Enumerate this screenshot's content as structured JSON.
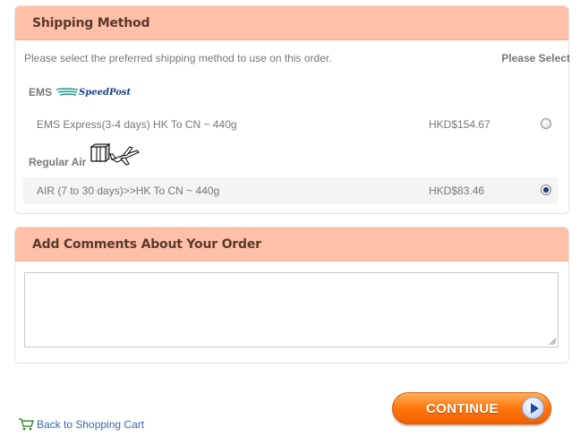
{
  "shipping": {
    "title": "Shipping Method",
    "intro": "Please select the preferred shipping method to use on this order.",
    "please_select": "Please Select",
    "groups": [
      {
        "name": "EMS",
        "logo_text": "SpeedPost",
        "icon": "speedpost-logo"
      },
      {
        "name": "Regular Air",
        "icon": "parcel-airplane-icon"
      }
    ],
    "options": [
      {
        "name": "EMS Express(3-4 days) HK To CN ~ 440g",
        "price": "HKD$154.67",
        "selected": false
      },
      {
        "name": "AIR (7 to 30 days)>>HK To CN ~ 440g",
        "price": "HKD$83.46",
        "selected": true
      }
    ]
  },
  "comments": {
    "title": "Add Comments About Your Order",
    "value": ""
  },
  "actions": {
    "continue_label": "CONTINUE",
    "back_label": "Back to Shopping Cart"
  },
  "colors": {
    "header_bg": "#ffc0a8",
    "continue_button": "#ff7a10",
    "link": "#3a67b4"
  }
}
